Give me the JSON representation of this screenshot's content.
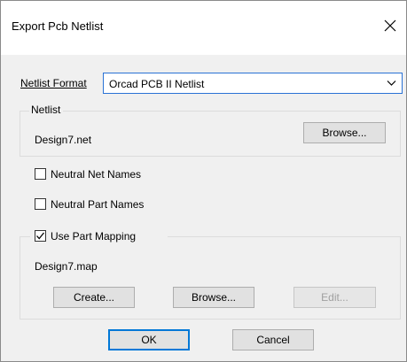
{
  "window": {
    "title": "Export Pcb Netlist",
    "close_glyph": "✕"
  },
  "netlist_format": {
    "label": "Netlist Format",
    "selected": "Orcad PCB II Netlist"
  },
  "netlist_group": {
    "legend": "Netlist",
    "filename": "Design7.net",
    "browse_label": "Browse..."
  },
  "options": {
    "neutral_net_names": {
      "label": "Neutral Net Names",
      "checked": false
    },
    "neutral_part_names": {
      "label": "Neutral Part Names",
      "checked": false
    },
    "use_part_mapping": {
      "label": "Use Part Mapping",
      "checked": true
    }
  },
  "mapping_group": {
    "filename": "Design7.map",
    "create_label": "Create...",
    "browse_label": "Browse...",
    "edit_label": "Edit..."
  },
  "footer": {
    "ok_label": "OK",
    "cancel_label": "Cancel"
  },
  "colors": {
    "accent": "#0078d7",
    "dialog_bg": "#f0f0f0"
  }
}
